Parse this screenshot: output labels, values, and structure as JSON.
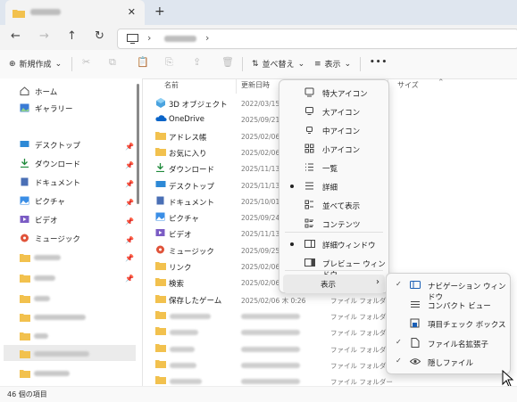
{
  "window": {
    "new_tab_symbol": "+",
    "close_tab_symbol": "✕"
  },
  "toolbar": {
    "new_label": "新規作成",
    "sort_label": "並べ替え",
    "view_label": "表示",
    "more_label": "•••"
  },
  "sidebar": {
    "items": [
      {
        "label": "ホーム",
        "icon": "home-icon"
      },
      {
        "label": "ギャラリー",
        "icon": "gallery-icon"
      },
      {
        "label": "デスクトップ",
        "icon": "desktop-icon"
      },
      {
        "label": "ダウンロード",
        "icon": "download-icon"
      },
      {
        "label": "ドキュメント",
        "icon": "document-icon"
      },
      {
        "label": "ピクチャ",
        "icon": "pictures-icon"
      },
      {
        "label": "ビデオ",
        "icon": "videos-icon"
      },
      {
        "label": "ミュージック",
        "icon": "music-icon"
      }
    ]
  },
  "columns": {
    "name": "名前",
    "date": "更新日時",
    "type": "",
    "size": "サイズ"
  },
  "files": [
    {
      "name": "3D オブジェクト",
      "date": "2022/03/15",
      "type": "",
      "icon": "3d-objects-icon"
    },
    {
      "name": "OneDrive",
      "date": "2025/09/21",
      "type": "",
      "icon": "onedrive-icon"
    },
    {
      "name": "アドレス帳",
      "date": "2025/02/06",
      "type": "",
      "icon": "folder-icon"
    },
    {
      "name": "お気に入り",
      "date": "2025/02/06",
      "type": "",
      "icon": "folder-icon"
    },
    {
      "name": "ダウンロード",
      "date": "2025/11/13",
      "type": "",
      "icon": "download-icon"
    },
    {
      "name": "デスクトップ",
      "date": "2025/11/13",
      "type": "",
      "icon": "desktop-icon"
    },
    {
      "name": "ドキュメント",
      "date": "2025/10/01",
      "type": "",
      "icon": "document-icon"
    },
    {
      "name": "ピクチャ",
      "date": "2025/09/24",
      "type": "",
      "icon": "pictures-icon"
    },
    {
      "name": "ビデオ",
      "date": "2025/11/13",
      "type": "",
      "icon": "videos-icon"
    },
    {
      "name": "ミュージック",
      "date": "2025/09/25",
      "type": "",
      "icon": "music-icon"
    },
    {
      "name": "リンク",
      "date": "2025/02/06",
      "type": "",
      "icon": "folder-icon"
    },
    {
      "name": "検索",
      "date": "2025/02/06",
      "type": "",
      "icon": "search-folder-icon"
    },
    {
      "name": "保存したゲーム",
      "date": "2025/02/06 木 0:26",
      "type": "ファイル フォルダー",
      "icon": "folder-icon"
    },
    {
      "name": "",
      "date": "",
      "type": "ファイル フォルダー",
      "icon": "folder-icon"
    },
    {
      "name": "",
      "date": "",
      "type": "ファイル フォルダー",
      "icon": "folder-icon"
    },
    {
      "name": "",
      "date": "",
      "type": "ファイル フォルダー",
      "icon": "folder-icon"
    },
    {
      "name": "",
      "date": "",
      "type": "ファイル フォルダー",
      "icon": "folder-icon"
    },
    {
      "name": "",
      "date": "",
      "type": "ファイル フォルダー",
      "icon": "folder-icon"
    }
  ],
  "view_menu": {
    "items": [
      {
        "label": "特大アイコン",
        "icon": "extra-large-icons-icon"
      },
      {
        "label": "大アイコン",
        "icon": "large-icons-icon"
      },
      {
        "label": "中アイコン",
        "icon": "medium-icons-icon"
      },
      {
        "label": "小アイコン",
        "icon": "small-icons-icon"
      },
      {
        "label": "一覧",
        "icon": "list-icon"
      },
      {
        "label": "詳細",
        "icon": "details-icon",
        "selected": true
      },
      {
        "label": "並べて表示",
        "icon": "tiles-icon"
      },
      {
        "label": "コンテンツ",
        "icon": "content-icon"
      },
      {
        "label": "詳細ウィンドウ",
        "icon": "details-pane-icon",
        "selected": true
      },
      {
        "label": "プレビュー ウィンドウ",
        "icon": "preview-pane-icon"
      },
      {
        "label": "表示",
        "icon": "",
        "submenu": true
      }
    ]
  },
  "show_submenu": {
    "items": [
      {
        "label": "ナビゲーション ウィンドウ",
        "icon": "navigation-pane-icon",
        "checked": true
      },
      {
        "label": "コンパクト ビュー",
        "icon": "compact-view-icon",
        "checked": false
      },
      {
        "label": "項目チェック ボックス",
        "icon": "item-checkbox-icon",
        "checked": false
      },
      {
        "label": "ファイル名拡張子",
        "icon": "file-extension-icon",
        "checked": true
      },
      {
        "label": "隠しファイル",
        "icon": "hidden-files-icon",
        "checked": true
      }
    ]
  },
  "status": {
    "count_text": "46 個の項目"
  },
  "colors": {
    "folder": "#f2c14e",
    "accent": "#0067c0",
    "titlebar": "#dfe6ef"
  }
}
